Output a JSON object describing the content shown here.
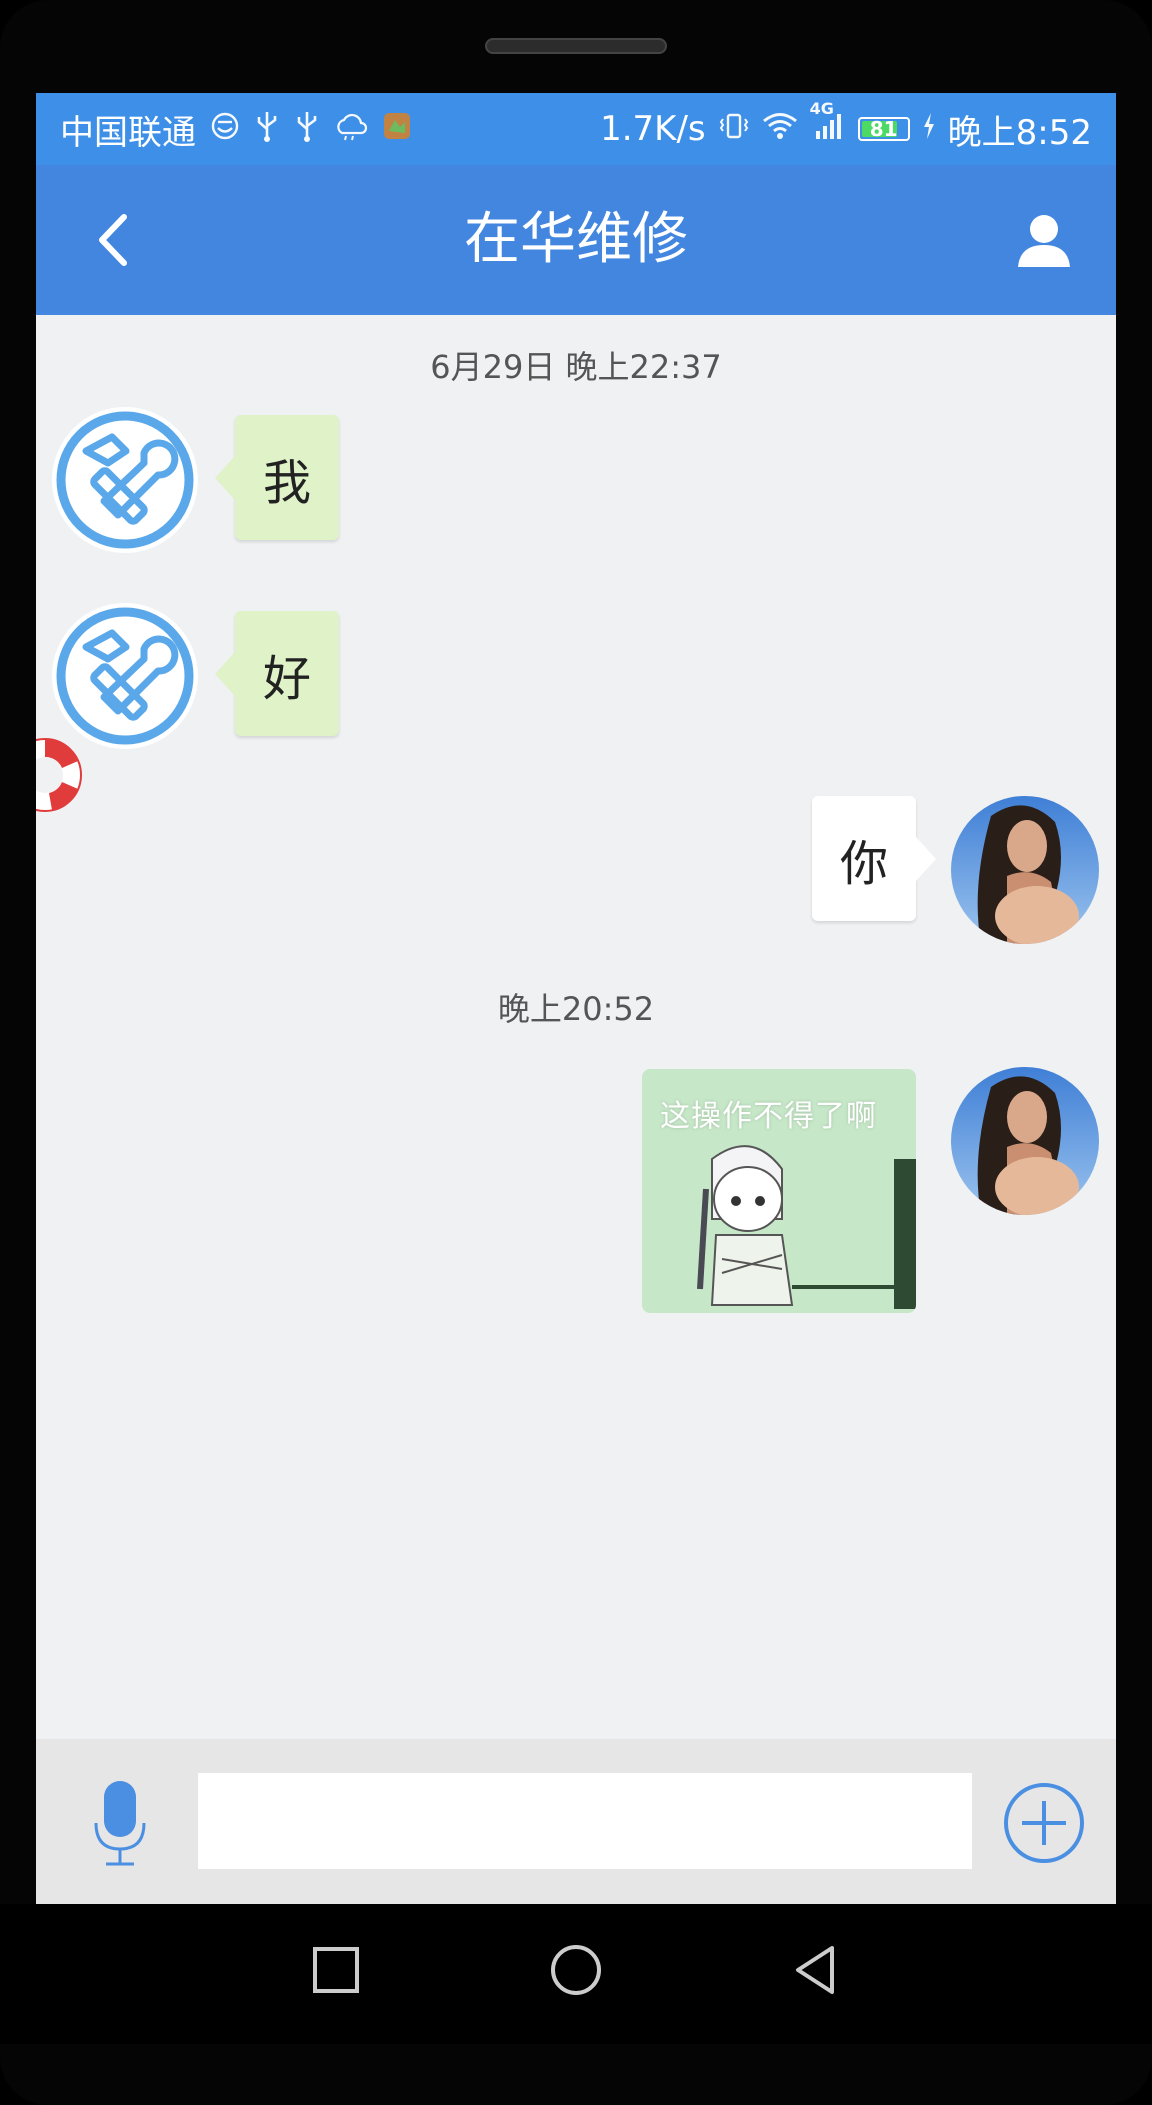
{
  "status_bar": {
    "carrier": "中国联通",
    "speed": "1.7K/s",
    "network": "4G",
    "battery": "81",
    "battery_level": 0.81,
    "time": "晚上8:52",
    "icons": [
      "smile-icon",
      "usb-icon",
      "usb-icon",
      "weather-icon",
      "app-notification-icon",
      "vibrate-icon",
      "wifi-icon",
      "signal-icon",
      "battery-icon",
      "charging-icon"
    ]
  },
  "app_bar": {
    "title": "在华维修",
    "back_icon": "chevron-left-icon",
    "contact_icon": "person-icon"
  },
  "chat": {
    "timestamps": [
      "6月29日 晚上22:37",
      "晚上20:52"
    ],
    "messages": [
      {
        "side": "left",
        "sender_avatar": "repair-tools-icon",
        "text": "我"
      },
      {
        "side": "left",
        "sender_avatar": "repair-tools-icon",
        "text": "好"
      },
      {
        "side": "right",
        "sender_avatar": "user-photo",
        "text": "你"
      },
      {
        "side": "right",
        "sender_avatar": "user-photo",
        "type": "sticker",
        "caption": "这操作不得了啊"
      }
    ],
    "floating_icon": "lifebuoy-icon"
  },
  "input_bar": {
    "voice_icon": "microphone-icon",
    "value": "",
    "placeholder": "",
    "add_icon": "plus-circle-icon"
  },
  "nav_bar": {
    "icons": [
      "recent-apps-icon",
      "home-icon",
      "back-icon"
    ]
  },
  "colors": {
    "status_bar": "#3d8fe8",
    "app_bar": "#4286e0",
    "chat_bg": "#f0f1f3",
    "green_bubble": "#dff2c8",
    "accent_blue": "#4a8fe2"
  }
}
